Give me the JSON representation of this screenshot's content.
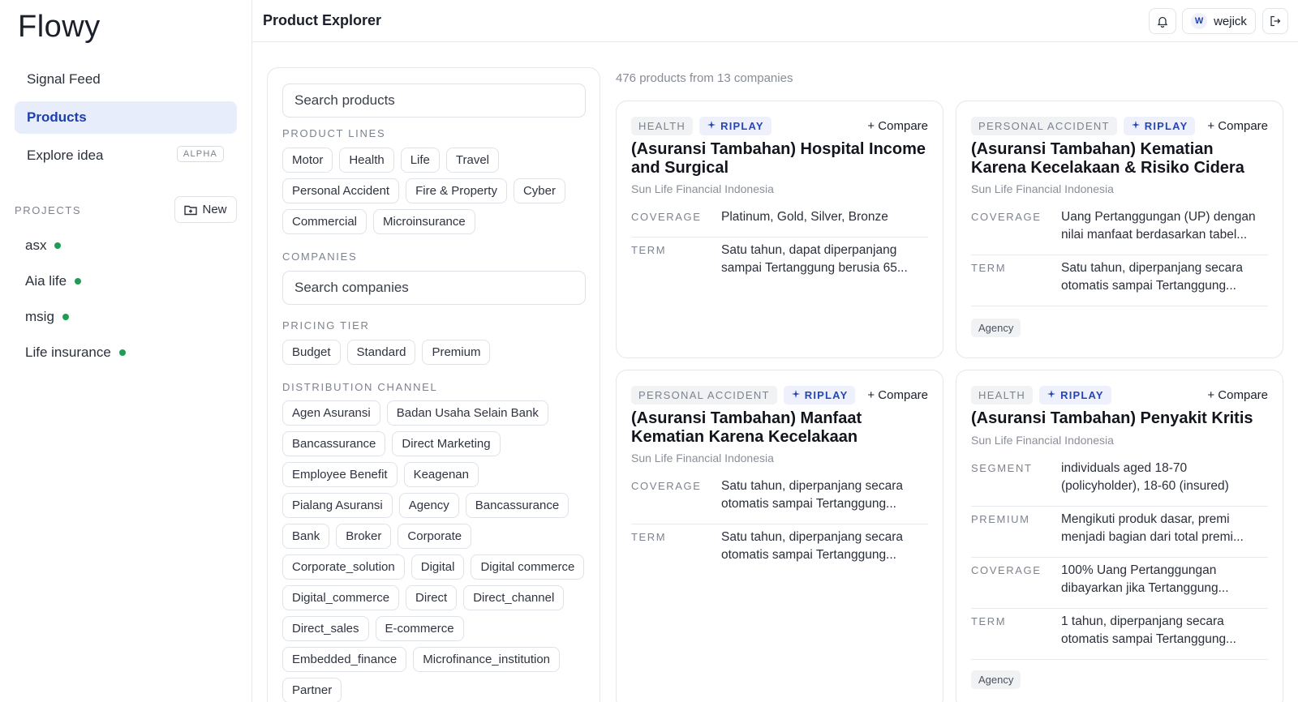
{
  "app": {
    "logo": "Flowy"
  },
  "sidebar": {
    "nav": [
      {
        "label": "Signal Feed"
      },
      {
        "label": "Products"
      },
      {
        "label": "Explore idea",
        "badge": "ALPHA"
      }
    ],
    "projects_label": "PROJECTS",
    "new_label": "New",
    "projects": [
      {
        "name": "asx"
      },
      {
        "name": "Aia life"
      },
      {
        "name": "msig"
      },
      {
        "name": "Life insurance"
      }
    ]
  },
  "header": {
    "title": "Product Explorer",
    "username": "wejick",
    "avatar_initial": "W"
  },
  "filters": {
    "search_placeholder": "Search products",
    "product_lines_label": "PRODUCT LINES",
    "product_lines": [
      "Motor",
      "Health",
      "Life",
      "Travel",
      "Personal Accident",
      "Fire & Property",
      "Cyber",
      "Commercial",
      "Microinsurance"
    ],
    "companies_label": "COMPANIES",
    "companies_placeholder": "Search companies",
    "pricing_label": "PRICING TIER",
    "pricing": [
      "Budget",
      "Standard",
      "Premium"
    ],
    "distribution_label": "DISTRIBUTION CHANNEL",
    "distribution": [
      "Agen Asuransi",
      "Badan Usaha Selain Bank",
      "Bancassurance",
      "Direct Marketing",
      "Employee Benefit",
      "Keagenan",
      "Pialang Asuransi",
      "Agency",
      "Bancassurance",
      "Bank",
      "Broker",
      "Corporate",
      "Corporate_solution",
      "Digital",
      "Digital commerce",
      "Digital_commerce",
      "Direct",
      "Direct_channel",
      "Direct_sales",
      "E-commerce",
      "Embedded_finance",
      "Microfinance_institution",
      "Partner"
    ]
  },
  "results": {
    "count_text": "476 products from 13 companies",
    "compare_label": "+ Compare",
    "riplay_label": "RIPLAY",
    "cards": [
      {
        "category": "HEALTH",
        "title": "(Asuransi Tambahan) Hospital Income and Surgical",
        "company": "Sun Life Financial Indonesia",
        "rows": [
          {
            "label": "COVERAGE",
            "value": "Platinum, Gold, Silver, Bronze"
          },
          {
            "label": "TERM",
            "value": "Satu tahun, dapat diperpanjang sampai Tertanggung berusia 65..."
          }
        ],
        "channel": ""
      },
      {
        "category": "PERSONAL ACCIDENT",
        "title": "(Asuransi Tambahan) Kematian Karena Kecelakaan & Risiko Cidera",
        "company": "Sun Life Financial Indonesia",
        "rows": [
          {
            "label": "COVERAGE",
            "value": "Uang Pertanggungan (UP) dengan nilai manfaat berdasarkan tabel..."
          },
          {
            "label": "TERM",
            "value": "Satu tahun, diperpanjang secara otomatis sampai Tertanggung..."
          }
        ],
        "channel": "Agency"
      },
      {
        "category": "PERSONAL ACCIDENT",
        "title": "(Asuransi Tambahan) Manfaat Kematian Karena Kecelakaan",
        "company": "Sun Life Financial Indonesia",
        "rows": [
          {
            "label": "COVERAGE",
            "value": "Satu tahun, diperpanjang secara otomatis sampai Tertanggung..."
          },
          {
            "label": "TERM",
            "value": "Satu tahun, diperpanjang secara otomatis sampai Tertanggung..."
          }
        ],
        "channel": ""
      },
      {
        "category": "HEALTH",
        "title": "(Asuransi Tambahan) Penyakit Kritis",
        "company": "Sun Life Financial Indonesia",
        "rows": [
          {
            "label": "SEGMENT",
            "value": "individuals aged 18-70 (policyholder), 18-60 (insured)"
          },
          {
            "label": "PREMIUM",
            "value": "Mengikuti produk dasar, premi menjadi bagian dari total premi..."
          },
          {
            "label": "COVERAGE",
            "value": "100% Uang Pertanggungan dibayarkan jika Tertanggung..."
          },
          {
            "label": "TERM",
            "value": "1 tahun, diperpanjang secara otomatis sampai Tertanggung..."
          }
        ],
        "channel": "Agency"
      }
    ]
  }
}
